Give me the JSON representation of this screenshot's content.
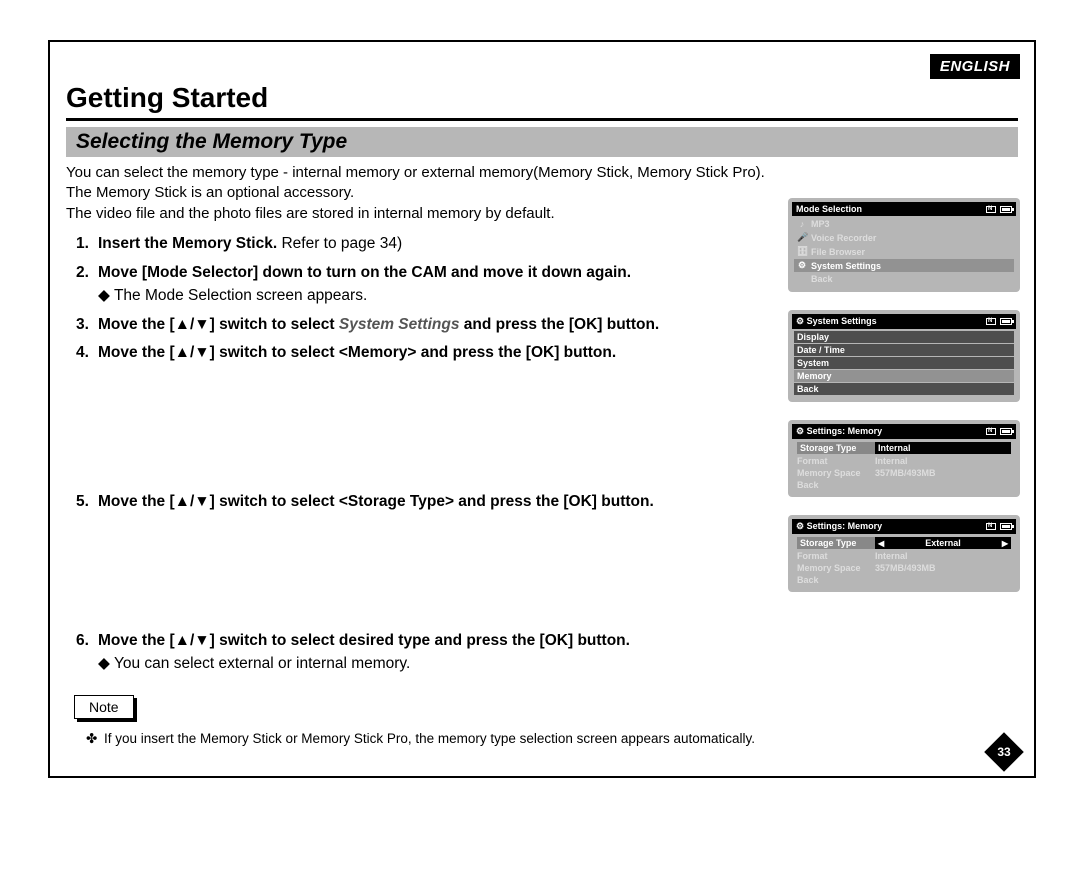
{
  "header": {
    "lang": "ENGLISH",
    "chapter": "Getting Started",
    "section": "Selecting the Memory Type",
    "page_number": "33"
  },
  "intro": {
    "l1": "You can select the memory type - internal memory or external memory(Memory Stick, Memory Stick Pro).",
    "l2": "The Memory Stick is an optional accessory.",
    "l3": "The video file and the photo files are stored in internal memory by default."
  },
  "steps": {
    "s1_a": "Insert the Memory Stick.",
    "s1_b": " Refer to page 34)",
    "s2_a": "Move [Mode Selector] down to turn on the CAM and move it down again.",
    "s2_sub": "The Mode Selection screen appears.",
    "s3_pre": "Move the [",
    "s3_mid": "] switch to select ",
    "s3_target": "System Settings",
    "s3_post": " and press the [OK] button.",
    "s4_pre": "Move the [",
    "s4_mid": "] switch to select <Memory> and press the [OK] button.",
    "s5_pre": "Move the [",
    "s5_mid": "] switch to select <Storage Type> and press the [OK] button.",
    "s6_pre": "Move the [",
    "s6_mid": "] switch to select desired type and press the [OK] button.",
    "s6_sub": "You can select external or internal memory.",
    "arrows": "▲/▼"
  },
  "note": {
    "label": "Note",
    "item": "If you insert the Memory Stick or Memory Stick Pro, the memory type selection screen appears automatically."
  },
  "screens": {
    "s3": {
      "title": "Mode Selection",
      "items": [
        "MP3",
        "Voice Recorder",
        "File Browser",
        "System Settings",
        "Back"
      ],
      "icons": [
        "♪",
        "🎤",
        "🗄",
        "⚙",
        ""
      ],
      "sel_index": 3
    },
    "s4": {
      "title_icon": "⚙",
      "title": "System Settings",
      "items": [
        "Display",
        "Date / Time",
        "System",
        "Memory",
        "Back"
      ],
      "sel_index": 3
    },
    "s5": {
      "title_icon": "⚙",
      "title": "Settings: Memory",
      "rows": [
        {
          "k": "Storage Type",
          "v": "Internal",
          "sel": true
        },
        {
          "k": "Format",
          "v": "Internal"
        },
        {
          "k": "Memory Space",
          "v": "357MB/493MB"
        },
        {
          "k": "Back",
          "v": ""
        }
      ]
    },
    "s6": {
      "title_icon": "⚙",
      "title": "Settings: Memory",
      "rows": [
        {
          "k": "Storage Type",
          "v": "External",
          "sel": true,
          "arrows": true
        },
        {
          "k": "Format",
          "v": "Internal"
        },
        {
          "k": "Memory Space",
          "v": "357MB/493MB"
        },
        {
          "k": "Back",
          "v": ""
        }
      ]
    }
  }
}
